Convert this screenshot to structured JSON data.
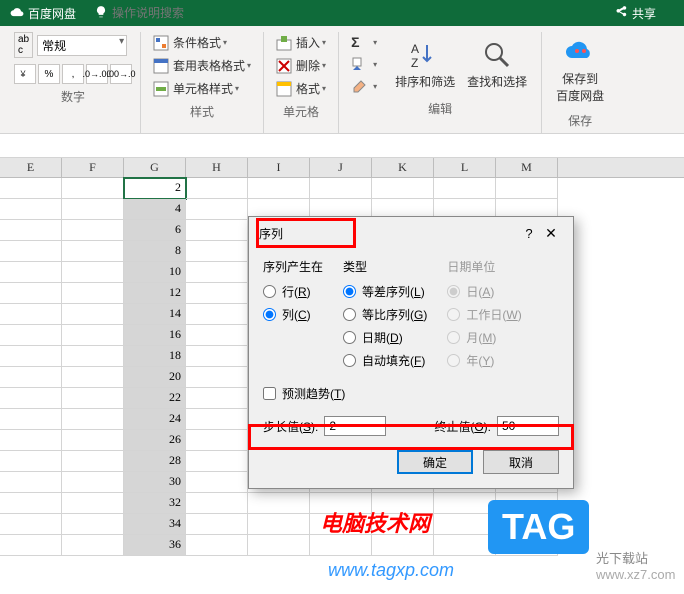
{
  "titlebar": {
    "netdisk": "百度网盘",
    "search_placeholder": "操作说明搜索",
    "share": "共享"
  },
  "ribbon": {
    "number": {
      "format": "常规",
      "label": "数字"
    },
    "styles": {
      "cond_format": "条件格式",
      "table_format": "套用表格格式",
      "cell_style": "单元格样式",
      "label": "样式"
    },
    "cells": {
      "insert": "插入",
      "delete": "删除",
      "format": "格式",
      "label": "单元格"
    },
    "editing": {
      "sort_filter": "排序和筛选",
      "find_select": "查找和选择",
      "label": "编辑"
    },
    "save": {
      "save_to": "保存到",
      "netdisk": "百度网盘",
      "label": "保存"
    }
  },
  "sheet": {
    "columns": [
      "E",
      "F",
      "G",
      "H",
      "I",
      "J",
      "K",
      "L",
      "M"
    ],
    "g_values": [
      2,
      4,
      6,
      8,
      10,
      12,
      14,
      16,
      18,
      20,
      22,
      24,
      26,
      28,
      30,
      32,
      34,
      36
    ]
  },
  "dialog": {
    "title": "序列",
    "series_in": "序列产生在",
    "row": "行(R)",
    "col": "列(C)",
    "type": "类型",
    "arith": "等差序列(L)",
    "geom": "等比序列(G)",
    "date": "日期(D)",
    "autofill": "自动填充(F)",
    "date_unit": "日期单位",
    "day": "日(A)",
    "weekday": "工作日(W)",
    "month": "月(M)",
    "year": "年(Y)",
    "trend": "预测趋势(T)",
    "step_label": "步长值(S):",
    "step_value": "2",
    "stop_label": "终止值(O):",
    "stop_value": "50",
    "ok": "确定",
    "cancel": "取消"
  },
  "watermark": {
    "text": "电脑技术网",
    "url": "www.tagxp.com",
    "tag": "TAG",
    "dl": "光下载站",
    "dl_url": "www.xz7.com"
  }
}
